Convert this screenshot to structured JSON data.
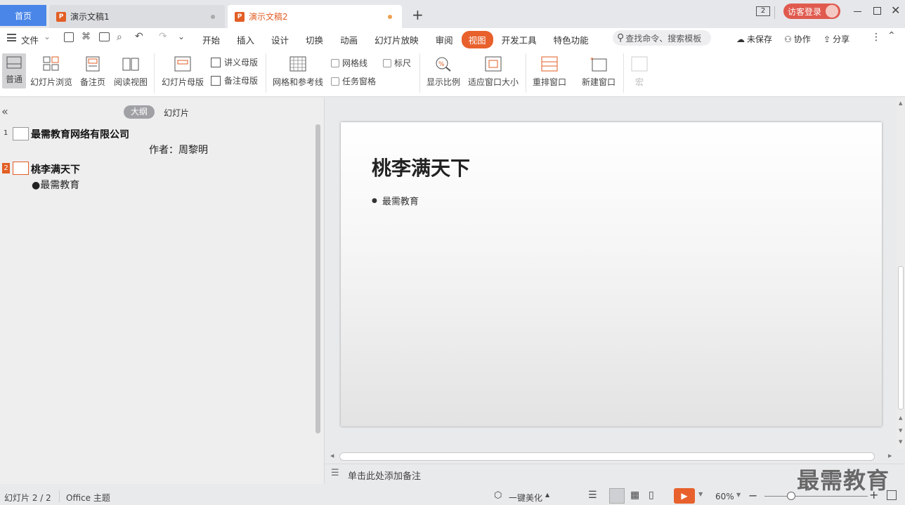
{
  "tabs": {
    "home": "首页",
    "doc1": "演示文稿1",
    "doc2": "演示文稿2",
    "new_tab": "+"
  },
  "titlebar": {
    "badge": "2",
    "login": "访客登录"
  },
  "menu": {
    "file": "文件",
    "items": [
      "开始",
      "插入",
      "设计",
      "切换",
      "动画",
      "幻灯片放映",
      "审阅",
      "视图",
      "开发工具",
      "特色功能"
    ],
    "active": "视图",
    "search_placeholder": "查找命令、搜索模板",
    "unsaved": "未保存",
    "collab": "协作",
    "share": "分享"
  },
  "ribbon": {
    "normal": "普通",
    "browse": "幻灯片浏览",
    "notes_page": "备注页",
    "reading": "阅读视图",
    "slide_master": "幻灯片母版",
    "handout_master": "讲义母版",
    "notes_master": "备注母版",
    "grid_guides": "网格和参考线",
    "gridlines": "网格线",
    "ruler": "标尺",
    "task_pane": "任务窗格",
    "zoom": "显示比例",
    "fit_window": "适应窗口大小",
    "arrange": "重排窗口",
    "new_window": "新建窗口",
    "macro": "宏"
  },
  "outline": {
    "tab_outline": "大纲",
    "tab_slides": "幻灯片",
    "items": [
      {
        "num": "1",
        "title": "最需教育网络有限公司",
        "sub": "作者：周黎明"
      },
      {
        "num": "2",
        "title": "桃李满天下",
        "sub": "●最需教育"
      }
    ]
  },
  "slide": {
    "title": "桃李满天下",
    "bullet": "最需教育"
  },
  "notes": {
    "placeholder": "单击此处添加备注"
  },
  "status": {
    "slide_count": "幻灯片 2 / 2",
    "theme": "Office 主题",
    "beautify": "一键美化",
    "zoom": "60%"
  },
  "watermark": "最需教育"
}
